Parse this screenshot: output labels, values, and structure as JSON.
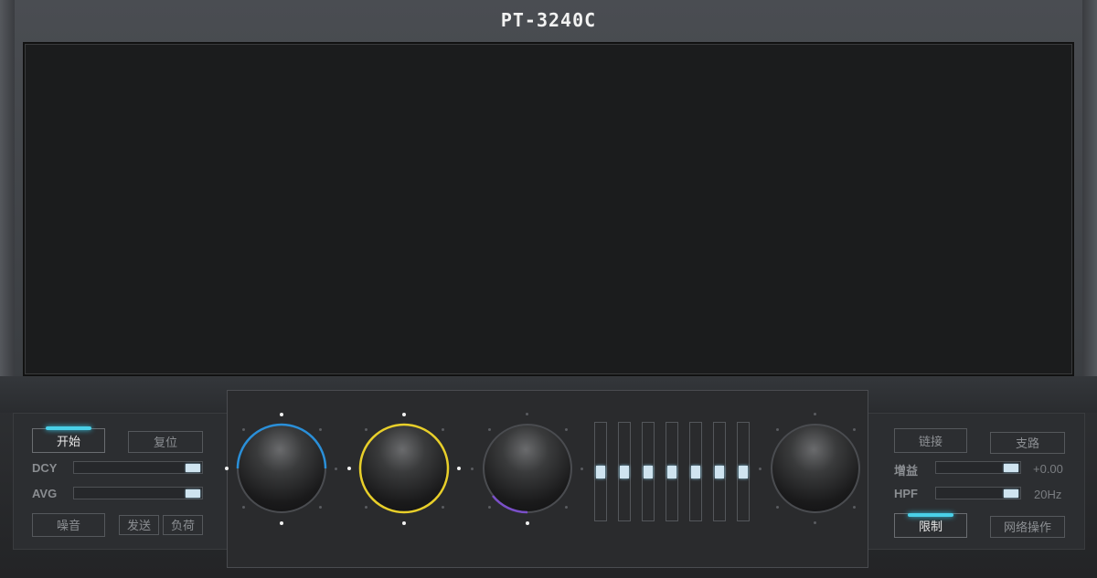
{
  "title": "PT-3240C",
  "left_panel": {
    "start": "开始",
    "reset": "复位",
    "dcy_label": "DCY",
    "avg_label": "AVG",
    "noise": "噪音",
    "send": "发送",
    "load": "负荷",
    "dcy_level": 1.0,
    "avg_level": 1.0
  },
  "right_panel": {
    "link": "链接",
    "branch": "支路",
    "gain_label": "增益",
    "gain_value": "+0.00",
    "hpf_label": "HPF",
    "hpf_value": "20Hz",
    "limit": "限制",
    "network_ops": "网络操作",
    "gain_level": 1.0,
    "hpf_level": 1.0
  },
  "knobs": [
    {
      "name": "knob-1",
      "ring_color": "#2a8fd8"
    },
    {
      "name": "knob-2",
      "ring_color": "#e8cf2a"
    },
    {
      "name": "knob-3",
      "ring_color": "#7a4fc8"
    },
    {
      "name": "knob-4",
      "ring_color": "#4a4c50"
    }
  ],
  "faders": {
    "count": 7,
    "level": 0.5
  },
  "colors": {
    "accent": "#4ad0e8",
    "thumb": "#cfe4f0"
  }
}
